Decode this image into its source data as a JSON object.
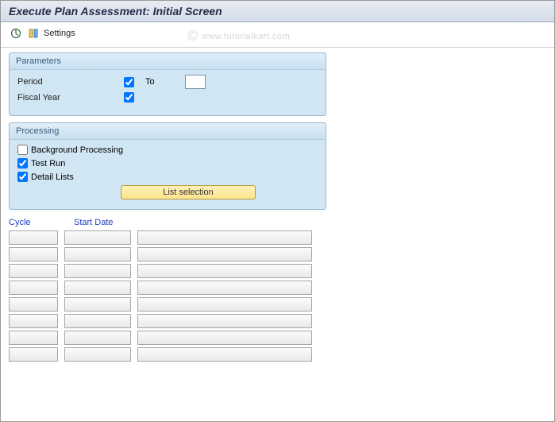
{
  "title": "Execute Plan Assessment: Initial Screen",
  "toolbar": {
    "settings_label": "Settings"
  },
  "watermark": {
    "copy": "©",
    "text": "www.tutorialkart.com"
  },
  "parameters": {
    "group_title": "Parameters",
    "period_label": "Period",
    "period_selected": true,
    "period_from": "",
    "to_label": "To",
    "period_to": "",
    "fiscal_year_label": "Fiscal Year",
    "fiscal_year_selected": true,
    "fiscal_year_value": ""
  },
  "processing": {
    "group_title": "Processing",
    "background_label": "Background Processing",
    "background_checked": false,
    "testrun_label": "Test Run",
    "testrun_checked": true,
    "detail_label": "Detail Lists",
    "detail_checked": true,
    "list_selection_label": "List selection"
  },
  "grid": {
    "cycle_header": "Cycle",
    "startdate_header": "Start Date",
    "rows": [
      {
        "cycle": "",
        "start": "",
        "desc": ""
      },
      {
        "cycle": "",
        "start": "",
        "desc": ""
      },
      {
        "cycle": "",
        "start": "",
        "desc": ""
      },
      {
        "cycle": "",
        "start": "",
        "desc": ""
      },
      {
        "cycle": "",
        "start": "",
        "desc": ""
      },
      {
        "cycle": "",
        "start": "",
        "desc": ""
      },
      {
        "cycle": "",
        "start": "",
        "desc": ""
      },
      {
        "cycle": "",
        "start": "",
        "desc": ""
      }
    ]
  }
}
